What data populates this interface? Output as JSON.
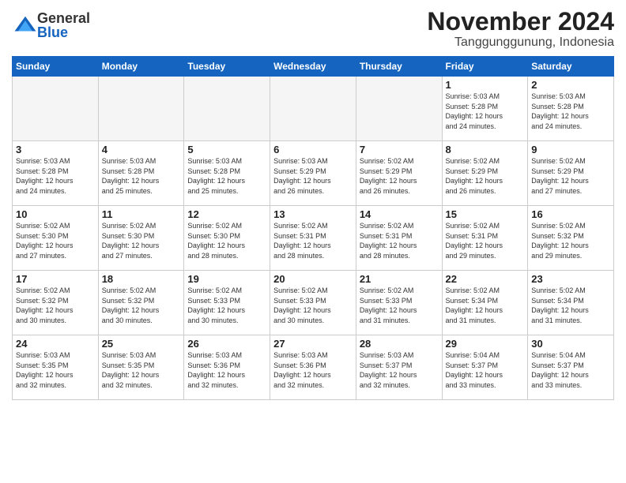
{
  "logo": {
    "general": "General",
    "blue": "Blue"
  },
  "title": {
    "month": "November 2024",
    "location": "Tanggunggunung, Indonesia"
  },
  "headers": [
    "Sunday",
    "Monday",
    "Tuesday",
    "Wednesday",
    "Thursday",
    "Friday",
    "Saturday"
  ],
  "weeks": [
    [
      {
        "day": "",
        "info": ""
      },
      {
        "day": "",
        "info": ""
      },
      {
        "day": "",
        "info": ""
      },
      {
        "day": "",
        "info": ""
      },
      {
        "day": "",
        "info": ""
      },
      {
        "day": "1",
        "info": "Sunrise: 5:03 AM\nSunset: 5:28 PM\nDaylight: 12 hours\nand 24 minutes."
      },
      {
        "day": "2",
        "info": "Sunrise: 5:03 AM\nSunset: 5:28 PM\nDaylight: 12 hours\nand 24 minutes."
      }
    ],
    [
      {
        "day": "3",
        "info": "Sunrise: 5:03 AM\nSunset: 5:28 PM\nDaylight: 12 hours\nand 24 minutes."
      },
      {
        "day": "4",
        "info": "Sunrise: 5:03 AM\nSunset: 5:28 PM\nDaylight: 12 hours\nand 25 minutes."
      },
      {
        "day": "5",
        "info": "Sunrise: 5:03 AM\nSunset: 5:28 PM\nDaylight: 12 hours\nand 25 minutes."
      },
      {
        "day": "6",
        "info": "Sunrise: 5:03 AM\nSunset: 5:29 PM\nDaylight: 12 hours\nand 26 minutes."
      },
      {
        "day": "7",
        "info": "Sunrise: 5:02 AM\nSunset: 5:29 PM\nDaylight: 12 hours\nand 26 minutes."
      },
      {
        "day": "8",
        "info": "Sunrise: 5:02 AM\nSunset: 5:29 PM\nDaylight: 12 hours\nand 26 minutes."
      },
      {
        "day": "9",
        "info": "Sunrise: 5:02 AM\nSunset: 5:29 PM\nDaylight: 12 hours\nand 27 minutes."
      }
    ],
    [
      {
        "day": "10",
        "info": "Sunrise: 5:02 AM\nSunset: 5:30 PM\nDaylight: 12 hours\nand 27 minutes."
      },
      {
        "day": "11",
        "info": "Sunrise: 5:02 AM\nSunset: 5:30 PM\nDaylight: 12 hours\nand 27 minutes."
      },
      {
        "day": "12",
        "info": "Sunrise: 5:02 AM\nSunset: 5:30 PM\nDaylight: 12 hours\nand 28 minutes."
      },
      {
        "day": "13",
        "info": "Sunrise: 5:02 AM\nSunset: 5:31 PM\nDaylight: 12 hours\nand 28 minutes."
      },
      {
        "day": "14",
        "info": "Sunrise: 5:02 AM\nSunset: 5:31 PM\nDaylight: 12 hours\nand 28 minutes."
      },
      {
        "day": "15",
        "info": "Sunrise: 5:02 AM\nSunset: 5:31 PM\nDaylight: 12 hours\nand 29 minutes."
      },
      {
        "day": "16",
        "info": "Sunrise: 5:02 AM\nSunset: 5:32 PM\nDaylight: 12 hours\nand 29 minutes."
      }
    ],
    [
      {
        "day": "17",
        "info": "Sunrise: 5:02 AM\nSunset: 5:32 PM\nDaylight: 12 hours\nand 30 minutes."
      },
      {
        "day": "18",
        "info": "Sunrise: 5:02 AM\nSunset: 5:32 PM\nDaylight: 12 hours\nand 30 minutes."
      },
      {
        "day": "19",
        "info": "Sunrise: 5:02 AM\nSunset: 5:33 PM\nDaylight: 12 hours\nand 30 minutes."
      },
      {
        "day": "20",
        "info": "Sunrise: 5:02 AM\nSunset: 5:33 PM\nDaylight: 12 hours\nand 30 minutes."
      },
      {
        "day": "21",
        "info": "Sunrise: 5:02 AM\nSunset: 5:33 PM\nDaylight: 12 hours\nand 31 minutes."
      },
      {
        "day": "22",
        "info": "Sunrise: 5:02 AM\nSunset: 5:34 PM\nDaylight: 12 hours\nand 31 minutes."
      },
      {
        "day": "23",
        "info": "Sunrise: 5:02 AM\nSunset: 5:34 PM\nDaylight: 12 hours\nand 31 minutes."
      }
    ],
    [
      {
        "day": "24",
        "info": "Sunrise: 5:03 AM\nSunset: 5:35 PM\nDaylight: 12 hours\nand 32 minutes."
      },
      {
        "day": "25",
        "info": "Sunrise: 5:03 AM\nSunset: 5:35 PM\nDaylight: 12 hours\nand 32 minutes."
      },
      {
        "day": "26",
        "info": "Sunrise: 5:03 AM\nSunset: 5:36 PM\nDaylight: 12 hours\nand 32 minutes."
      },
      {
        "day": "27",
        "info": "Sunrise: 5:03 AM\nSunset: 5:36 PM\nDaylight: 12 hours\nand 32 minutes."
      },
      {
        "day": "28",
        "info": "Sunrise: 5:03 AM\nSunset: 5:37 PM\nDaylight: 12 hours\nand 32 minutes."
      },
      {
        "day": "29",
        "info": "Sunrise: 5:04 AM\nSunset: 5:37 PM\nDaylight: 12 hours\nand 33 minutes."
      },
      {
        "day": "30",
        "info": "Sunrise: 5:04 AM\nSunset: 5:37 PM\nDaylight: 12 hours\nand 33 minutes."
      }
    ]
  ]
}
